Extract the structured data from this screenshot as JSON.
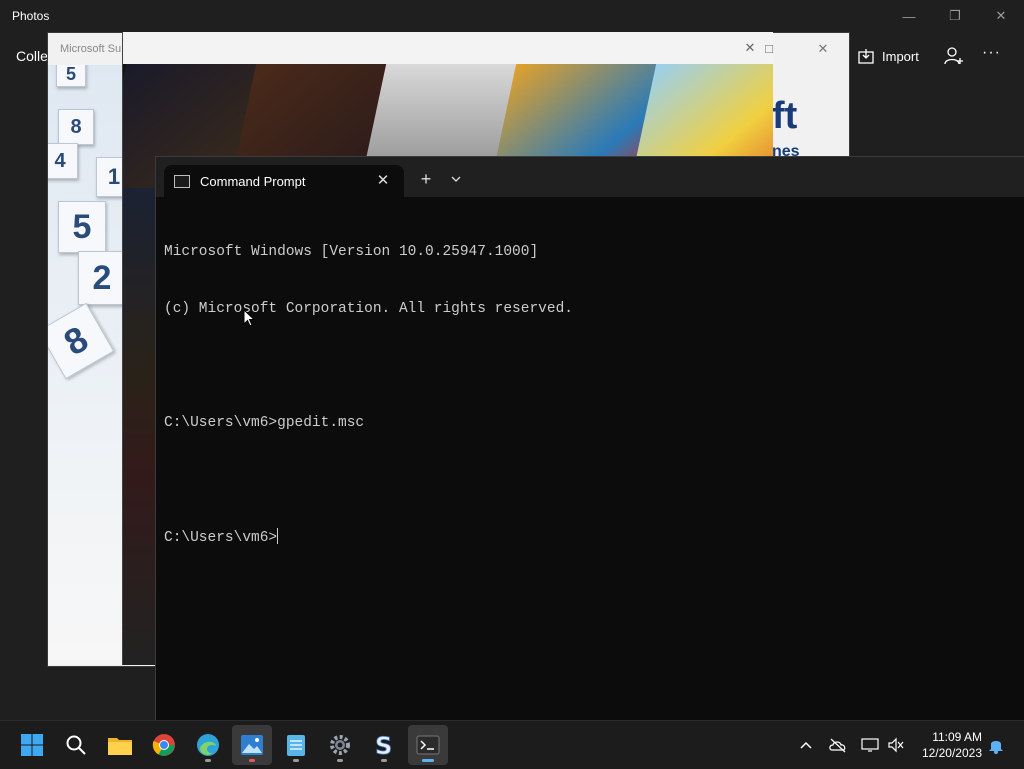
{
  "photos": {
    "title": "Photos",
    "toolbar_left": "Colle",
    "import_label": "Import",
    "more_label": "···"
  },
  "sudoku": {
    "title": "Microsoft Su",
    "logo_text": "ft",
    "logo_sub": "nes",
    "tiles": [
      "5",
      "8",
      "4",
      "1",
      "5",
      "2",
      "8"
    ]
  },
  "terminal": {
    "tab_label": "Command Prompt",
    "lines": [
      "Microsoft Windows [Version 10.0.25947.1000]",
      "(c) Microsoft Corporation. All rights reserved.",
      "",
      "C:\\Users\\vm6>gpedit.msc",
      "",
      "C:\\Users\\vm6>"
    ]
  },
  "taskbar": {
    "apps": [
      "start",
      "search",
      "file-explorer",
      "chrome",
      "edge-dev",
      "photos",
      "notepad",
      "settings",
      "app-s",
      "terminal"
    ],
    "time": "11:09 AM",
    "date": "12/20/2023"
  },
  "colors": {
    "accent": "#5fb2f2",
    "terminal_bg": "#0c0c0c",
    "taskbar_bg": "#1c1c1c"
  }
}
